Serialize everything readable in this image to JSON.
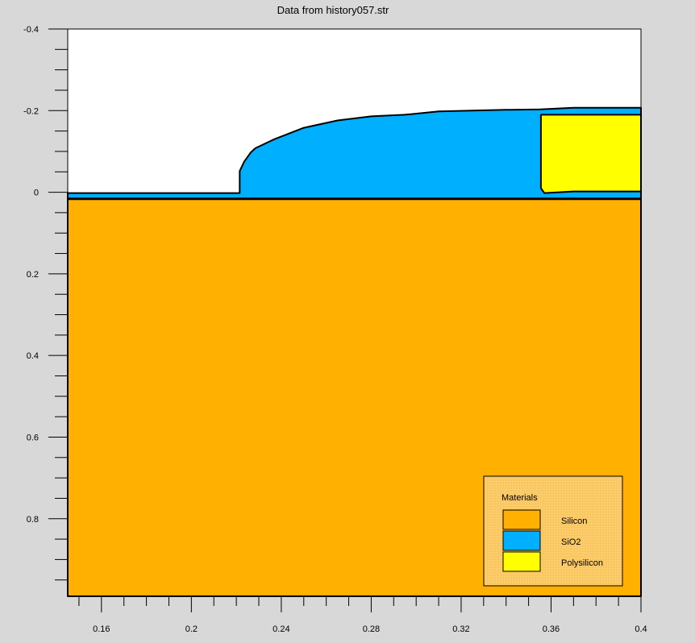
{
  "chart_data": {
    "type": "area",
    "title": "Data from history057.str",
    "xlabel": "",
    "ylabel": "",
    "xlim": [
      0.145,
      0.4
    ],
    "ylim": [
      -0.4,
      0.99
    ],
    "y_inverted": true,
    "x_ticks": [
      {
        "value": 0.16,
        "label": "0.16"
      },
      {
        "value": 0.2,
        "label": "0.2"
      },
      {
        "value": 0.24,
        "label": "0.24"
      },
      {
        "value": 0.28,
        "label": "0.28"
      },
      {
        "value": 0.32,
        "label": "0.32"
      },
      {
        "value": 0.36,
        "label": "0.36"
      },
      {
        "value": 0.4,
        "label": "0.4"
      }
    ],
    "y_ticks": [
      {
        "value": -0.4,
        "label": "-0.4"
      },
      {
        "value": -0.2,
        "label": "-0.2"
      },
      {
        "value": 0,
        "label": "0"
      },
      {
        "value": 0.2,
        "label": "0.2"
      },
      {
        "value": 0.4,
        "label": "0.4"
      },
      {
        "value": 0.6,
        "label": "0.6"
      },
      {
        "value": 0.8,
        "label": "0.8"
      }
    ],
    "materials": [
      {
        "name": "Silicon",
        "color": "#ffb000",
        "outline": [
          [
            0.145,
            0.016
          ],
          [
            0.4,
            0.016
          ],
          [
            0.4,
            0.99
          ],
          [
            0.145,
            0.99
          ]
        ]
      },
      {
        "name": "SiO2",
        "color": "#00b0ff",
        "outline": [
          [
            0.145,
            0.016
          ],
          [
            0.145,
            0.002
          ],
          [
            0.2215,
            0.002
          ],
          [
            0.2215,
            -0.052
          ],
          [
            0.2235,
            -0.075
          ],
          [
            0.2265,
            -0.098
          ],
          [
            0.2285,
            -0.108
          ],
          [
            0.237,
            -0.13
          ],
          [
            0.25,
            -0.158
          ],
          [
            0.265,
            -0.176
          ],
          [
            0.28,
            -0.186
          ],
          [
            0.295,
            -0.19
          ],
          [
            0.31,
            -0.198
          ],
          [
            0.325,
            -0.2
          ],
          [
            0.34,
            -0.202
          ],
          [
            0.355,
            -0.203
          ],
          [
            0.37,
            -0.207
          ],
          [
            0.4,
            -0.207
          ],
          [
            0.4,
            0.016
          ]
        ]
      },
      {
        "name": "Polysilicon",
        "color": "#ffff00",
        "outline": [
          [
            0.3555,
            -0.19
          ],
          [
            0.369,
            -0.19
          ],
          [
            0.4,
            -0.19
          ],
          [
            0.4,
            -0.002
          ],
          [
            0.37,
            -0.002
          ],
          [
            0.357,
            0.002
          ],
          [
            0.3555,
            -0.01
          ]
        ]
      }
    ],
    "interfaces": [
      [
        [
          0.145,
          0.016
        ],
        [
          0.4,
          0.016
        ]
      ]
    ],
    "legend": {
      "title": "Materials",
      "placement": "bottom-right",
      "entries": [
        {
          "label": "Silicon",
          "color": "#ffb000"
        },
        {
          "label": "SiO2",
          "color": "#00b0ff"
        },
        {
          "label": "Polysilicon",
          "color": "#ffff00"
        }
      ]
    }
  }
}
